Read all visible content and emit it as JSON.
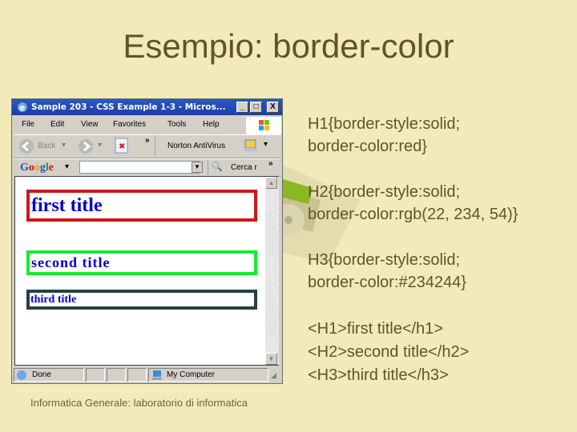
{
  "slide": {
    "title": "Esempio: border-color",
    "footer": "Informatica Generale: laboratorio di informatica"
  },
  "browser": {
    "window_title": "Sample 203 - CSS Example 1-3 - Micros...",
    "window_buttons": [
      "_",
      "□",
      "X"
    ],
    "menu": [
      "File",
      "Edit",
      "View",
      "Favorites",
      "Tools",
      "Help"
    ],
    "toolbar": {
      "back_label": "Back",
      "chevron": "»",
      "norton_label": "Norton AntiVirus"
    },
    "googlebar": {
      "logo": "Google",
      "search_value": "",
      "search_button": "Cerca r",
      "chevron": "»"
    },
    "page": {
      "h1_text": "first title",
      "h2_text": "second title",
      "h3_text": "third title",
      "colors": {
        "h1_border": "#d01818",
        "h2_border": "#16ea36",
        "h3_border": "#234244",
        "text": "#0000c8"
      }
    },
    "status": {
      "left_text": "Done",
      "zone_text": "My Computer"
    }
  },
  "code": {
    "lines": [
      "H1{border-style:solid;",
      "border-color:red}",
      "",
      "H2{border-style:solid;",
      "border-color:rgb(22, 234, 54)}",
      "",
      "H3{border-style:solid;",
      "border-color:#234244}",
      "",
      "<H1>first title</h1>",
      "<H2>second title</h2>",
      "<H3>third title</h3>"
    ]
  }
}
